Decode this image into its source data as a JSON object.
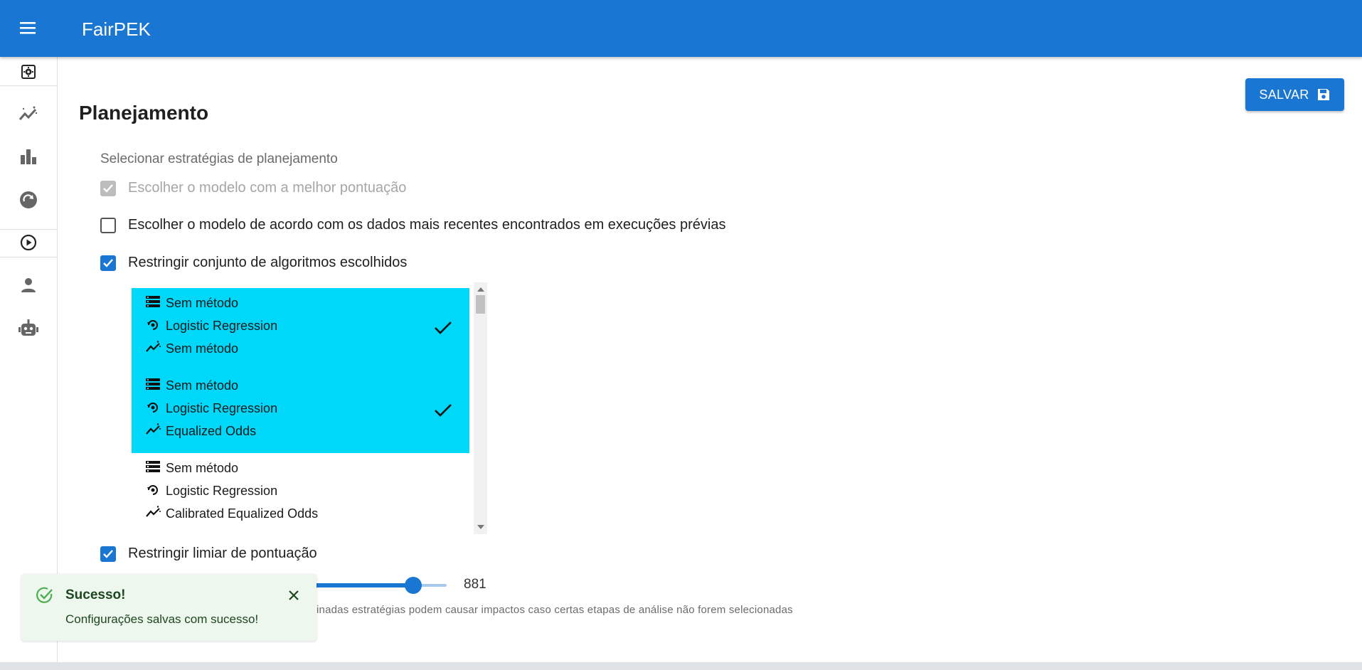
{
  "app": {
    "title": "FairPEK"
  },
  "sidebar": {
    "items": [
      {
        "icon": "settings-icon"
      },
      {
        "icon": "auto-graph-icon"
      },
      {
        "icon": "bar-chart-icon"
      },
      {
        "icon": "refresh-circle-icon"
      },
      {
        "icon": "play-circle-icon"
      },
      {
        "icon": "person-icon"
      },
      {
        "icon": "robot-icon"
      }
    ]
  },
  "page": {
    "title": "Planejamento",
    "save_label": "SALVAR"
  },
  "planning": {
    "section_label": "Selecionar estratégias de planejamento",
    "options": [
      {
        "label": "Escolher o modelo com a melhor pontuação",
        "checked": true,
        "disabled": true
      },
      {
        "label": "Escolher o modelo de acordo com os dados mais recentes encontrados em execuções prévias",
        "checked": false,
        "disabled": false
      },
      {
        "label": "Restringir conjunto de algoritmos escolhidos",
        "checked": true,
        "disabled": false
      }
    ],
    "algorithms": [
      {
        "preprocess": "Sem método",
        "model": "Logistic Regression",
        "postprocess": "Sem método",
        "selected": true
      },
      {
        "preprocess": "Sem método",
        "model": "Logistic Regression",
        "postprocess": "Equalized Odds",
        "selected": true
      },
      {
        "preprocess": "Sem método",
        "model": "Logistic Regression",
        "postprocess": "Calibrated Equalized Odds",
        "selected": false
      }
    ],
    "threshold": {
      "label": "Restringir limiar de pontuação",
      "checked": true,
      "value": "881",
      "helper": "inadas estratégias podem causar impactos caso certas etapas de análise não forem selecionadas"
    }
  },
  "toast": {
    "title": "Sucesso!",
    "message": "Configurações salvas com sucesso!"
  },
  "colors": {
    "primary": "#1976d2",
    "selected_row": "#00d8f9",
    "success_bg": "#edf7ed"
  }
}
